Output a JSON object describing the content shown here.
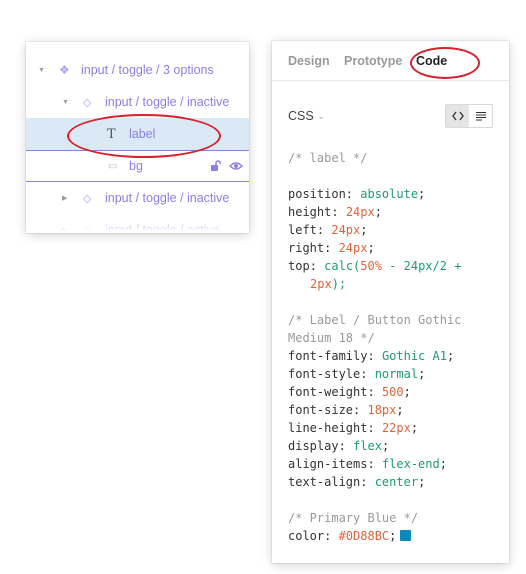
{
  "layers": {
    "rows": [
      {
        "label": "input / toggle / 3 options"
      },
      {
        "label": "input / toggle / inactive"
      },
      {
        "label": "label"
      },
      {
        "label": "bg"
      },
      {
        "label": "input / toggle / inactive"
      },
      {
        "label": "input / toggle / active"
      }
    ],
    "icons": {
      "component": "component-set-icon",
      "instance": "instance-icon",
      "text": "text-layer-icon",
      "rect": "rectangle-layer-icon",
      "lock": "unlock-icon",
      "eye": "eye-icon"
    }
  },
  "inspector": {
    "tabs": [
      "Design",
      "Prototype",
      "Code"
    ],
    "active_tab": "Code",
    "language": "CSS",
    "code": {
      "c1": "/* label */",
      "position": {
        "prop": "position",
        "val": "absolute"
      },
      "height": {
        "prop": "height",
        "val": "24px"
      },
      "left": {
        "prop": "left",
        "val": "24px"
      },
      "right": {
        "prop": "right",
        "val": "24px"
      },
      "top": {
        "prop": "top",
        "fn": "calc(",
        "a": "50%",
        "op": " - 24px/2 + ",
        "b": "2px",
        "end": ");"
      },
      "c2a": "/* Label / Button Gothic",
      "c2b": "Medium 18 */",
      "font_family": {
        "prop": "font-family",
        "val": "Gothic A1"
      },
      "font_style": {
        "prop": "font-style",
        "val": "normal"
      },
      "font_weight": {
        "prop": "font-weight",
        "val": "500"
      },
      "font_size": {
        "prop": "font-size",
        "val": "18px"
      },
      "line_height": {
        "prop": "line-height",
        "val": "22px"
      },
      "display": {
        "prop": "display",
        "val": "flex"
      },
      "align_items": {
        "prop": "align-items",
        "val": "flex-end"
      },
      "text_align": {
        "prop": "text-align",
        "val": "center"
      },
      "c3": "/* Primary Blue */",
      "color": {
        "prop": "color",
        "val": "#0D88BC"
      }
    }
  },
  "colors": {
    "accent": "#8b7fe8",
    "selection": "#dbe9f6",
    "annotation": "#d6232b",
    "code_value": "#1f9c6d",
    "code_number": "#e1643a",
    "primary_blue": "#0D88BC"
  }
}
